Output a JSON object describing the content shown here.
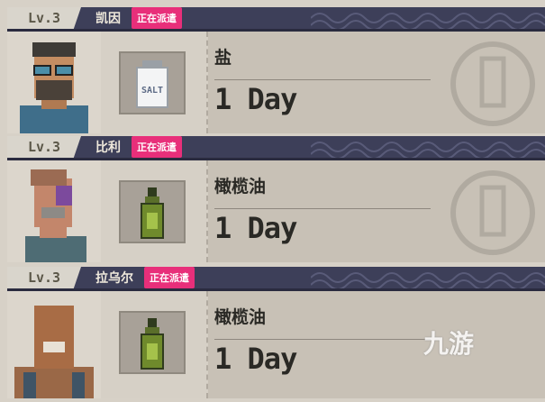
{
  "colors": {
    "header": "#3d3f59",
    "badge": "#e82f7a",
    "body": "#c8c1b6"
  },
  "cards": [
    {
      "level": "Lv.3",
      "name": "凯因",
      "status": "正在派遣",
      "item": "盐",
      "item_icon": "salt-shaker-icon",
      "item_label": "SALT",
      "duration": "1 Day"
    },
    {
      "level": "Lv.3",
      "name": "比利",
      "status": "正在派遣",
      "item": "橄榄油",
      "item_icon": "olive-oil-bottle-icon",
      "duration": "1 Day"
    },
    {
      "level": "Lv.3",
      "name": "拉乌尔",
      "status": "正在派遣",
      "item": "橄榄油",
      "item_icon": "olive-oil-bottle-icon",
      "duration": "1 Day"
    }
  ],
  "watermark": "九游"
}
